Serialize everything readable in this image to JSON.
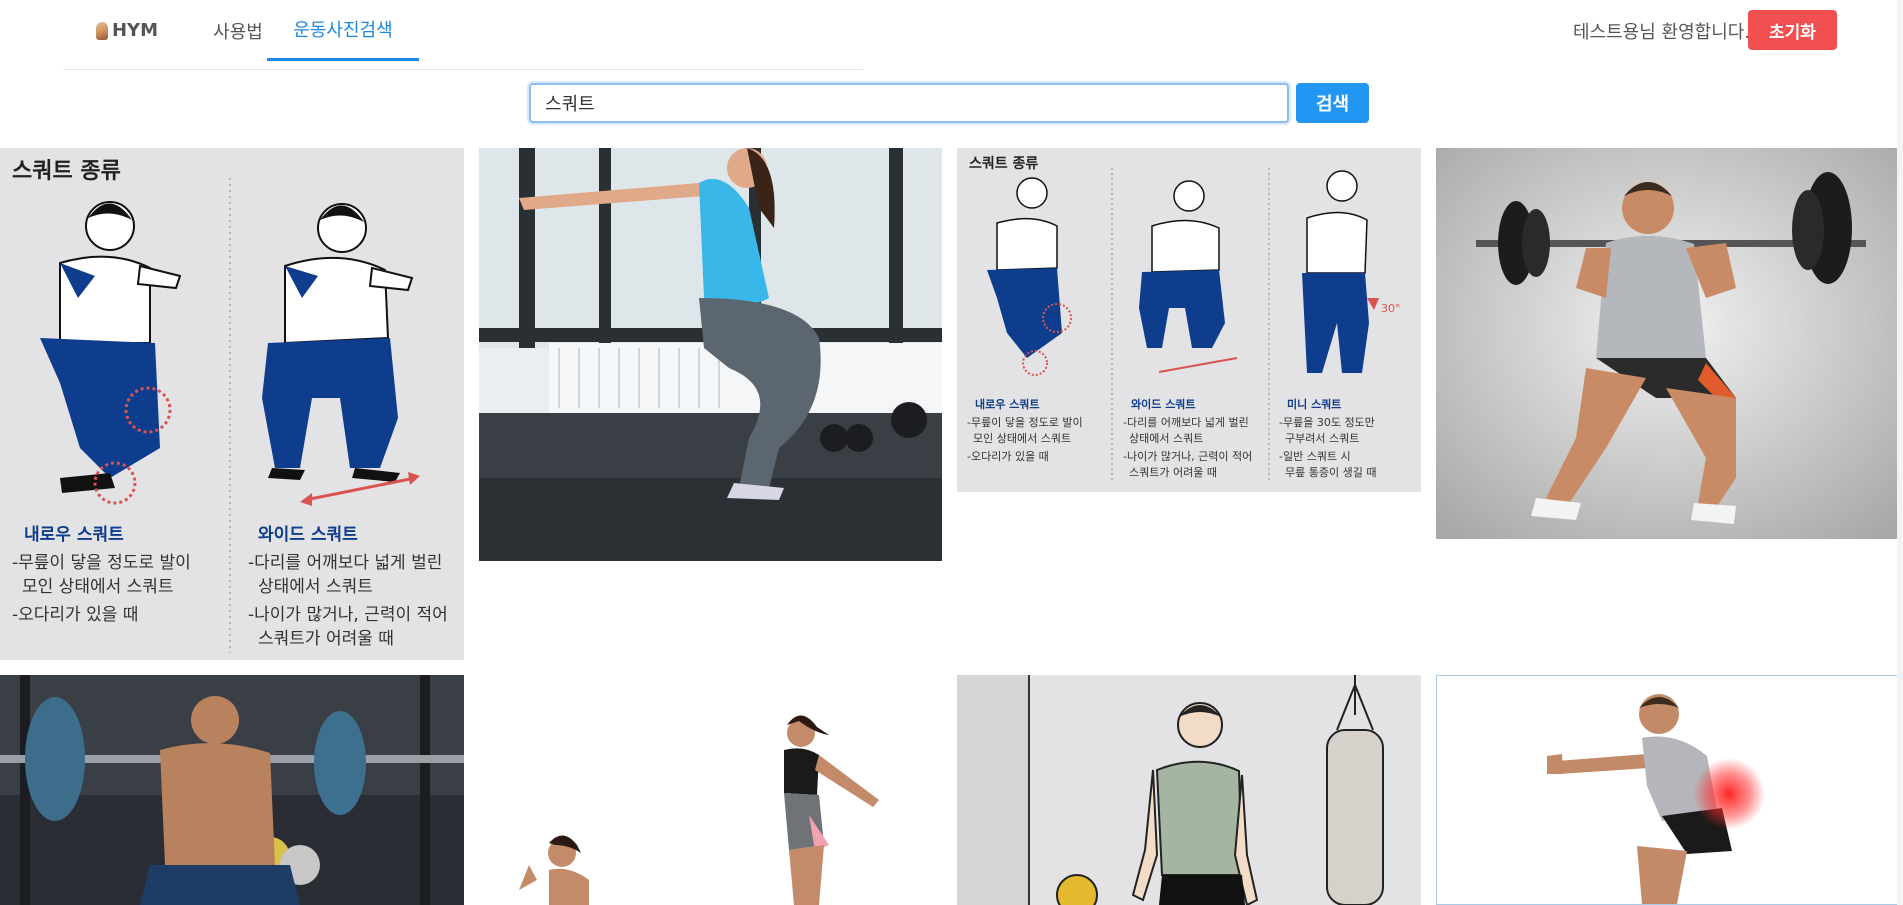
{
  "nav": {
    "logo_label": "HYM",
    "tabs": [
      {
        "label": "사용법"
      },
      {
        "label": "운동사진검색"
      }
    ]
  },
  "header": {
    "welcome_text": "테스트용님 환영합니다.",
    "reset_label": "초기화"
  },
  "search": {
    "value": "스쿼트",
    "button_label": "검색"
  },
  "results": {
    "infographic_large": {
      "heading": "스쿼트 종류",
      "types": [
        {
          "name": "내로우 스쿼트",
          "lines": [
            "-무릎이 닿을 정도로 발이",
            "모인 상태에서 스쿼트",
            "-오다리가 있을 때"
          ]
        },
        {
          "name": "와이드 스쿼트",
          "lines": [
            "-다리를 어깨보다 넓게 벌린",
            "상태에서 스쿼트",
            "-나이가 많거나, 근력이 적어",
            "스쿼트가 어려울 때"
          ]
        }
      ]
    },
    "infographic_small": {
      "heading": "스쿼트 종류",
      "angle_label": "30°",
      "types": [
        {
          "name": "내로우 스쿼트",
          "lines": [
            "-무릎이 닿을 정도로 발이",
            "모인 상태에서 스쿼트",
            "-오다리가 있을 때"
          ]
        },
        {
          "name": "와이드 스쿼트",
          "lines": [
            "-다리를 어깨보다 넓게 벌린",
            "상태에서 스쿼트",
            "-나이가 많거나, 근력이 적어",
            "스쿼트가 어려울 때"
          ]
        },
        {
          "name": "미니 스쿼트",
          "lines": [
            "-무릎을 30도 정도만",
            "구부려서 스쿼트",
            "-일반 스쿼트 시",
            "무릎 통증이 생길 때"
          ]
        }
      ]
    }
  },
  "colors": {
    "accent": "#1e88e5",
    "search_button": "#2196f3",
    "reset_button": "#f25050",
    "navy": "#0d3d8c"
  }
}
